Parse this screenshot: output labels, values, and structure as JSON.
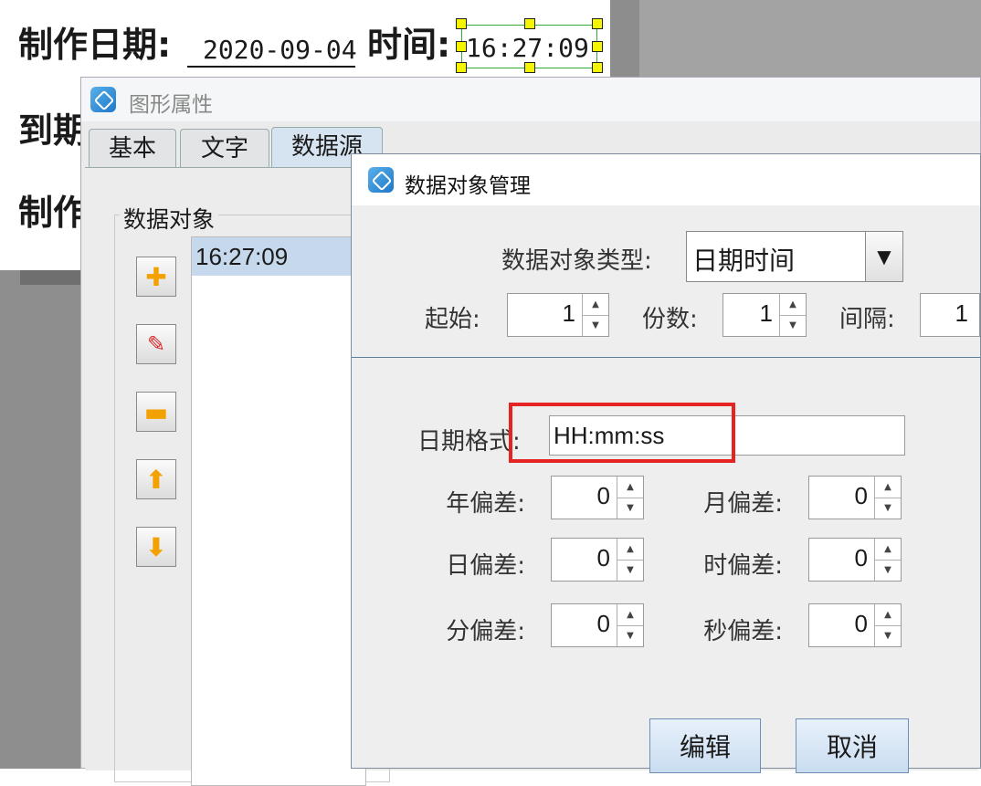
{
  "label": {
    "make_date_label": "制作日期:",
    "make_date_value": "2020-09-04",
    "time_label": "时间:",
    "time_value": "16:27:09",
    "expire_label": "到期",
    "make_label_2": "制作"
  },
  "props_window": {
    "title": "图形属性",
    "tabs": [
      "基本",
      "文字",
      "数据源"
    ],
    "active_tab": "数据源",
    "group_label": "数据对象",
    "buttons": [
      "add-icon",
      "edit-icon",
      "remove-icon",
      "move-up-icon",
      "move-down-icon"
    ],
    "list_items": [
      "16:27:09"
    ]
  },
  "dialog": {
    "title": "数据对象管理",
    "type_label": "数据对象类型:",
    "type_value": "日期时间",
    "start_label": "起始:",
    "start_value": "1",
    "copies_label": "份数:",
    "copies_value": "1",
    "interval_label": "间隔:",
    "interval_value": "1",
    "format_label": "日期格式:",
    "format_value": "HH:mm:ss",
    "year_offset_label": "年偏差:",
    "year_offset_value": "0",
    "month_offset_label": "月偏差:",
    "month_offset_value": "0",
    "day_offset_label": "日偏差:",
    "day_offset_value": "0",
    "hour_offset_label": "时偏差:",
    "hour_offset_value": "0",
    "minute_offset_label": "分偏差:",
    "minute_offset_value": "0",
    "second_offset_label": "秒偏差:",
    "second_offset_value": "0",
    "edit_button": "编辑",
    "cancel_button": "取消"
  },
  "colors": {
    "highlight_box": "#e52323",
    "selection_handle": "#f5f500",
    "list_selection": "#c6d8ec"
  }
}
